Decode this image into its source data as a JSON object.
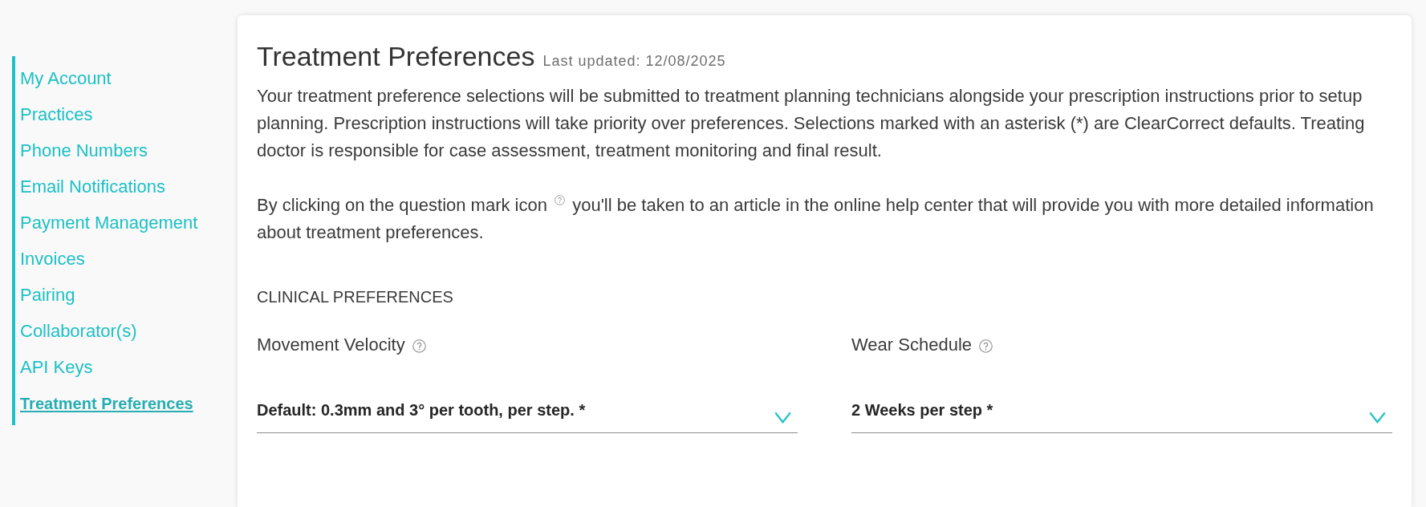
{
  "sidebar": {
    "items": [
      {
        "label": "My Account",
        "selected": false
      },
      {
        "label": "Practices",
        "selected": false
      },
      {
        "label": "Phone Numbers",
        "selected": false
      },
      {
        "label": "Email Notifications",
        "selected": false
      },
      {
        "label": "Payment Management",
        "selected": false
      },
      {
        "label": "Invoices",
        "selected": false
      },
      {
        "label": "Pairing",
        "selected": false
      },
      {
        "label": "Collaborator(s)",
        "selected": false
      },
      {
        "label": "API Keys",
        "selected": false
      },
      {
        "label": "Treatment Preferences",
        "selected": true
      }
    ]
  },
  "page": {
    "title": "Treatment Preferences",
    "last_updated": "Last updated: 12/08/2025",
    "intro": "Your treatment preference selections will be submitted to treatment planning technicians alongside your prescription instructions prior to setup planning. Prescription instructions will take priority over preferences. Selections marked with an asterisk (*) are ClearCorrect defaults. Treating doctor is responsible for case assessment, treatment monitoring and final result.",
    "help_note": {
      "before": "By clicking on the question mark icon",
      "after": "you'll be taken to an article in the online help center that will provide you with more detailed information about treatment preferences."
    }
  },
  "section": {
    "title": "CLINICAL PREFERENCES",
    "fields": [
      {
        "label": "Movement Velocity",
        "value": "Default: 0.3mm and 3° per tooth, per step. *"
      },
      {
        "label": "Wear Schedule",
        "value": "2 Weeks per step *"
      }
    ]
  }
}
